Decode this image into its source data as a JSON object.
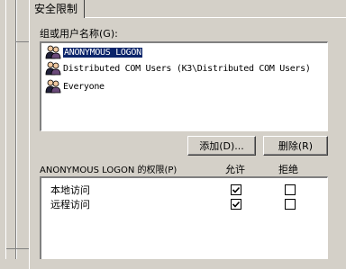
{
  "tab": {
    "label": "安全限制"
  },
  "group": {
    "label": "组或用户名称(G):"
  },
  "users": [
    {
      "name": "ANONYMOUS LOGON",
      "selected": true,
      "icon": "users-icon"
    },
    {
      "name": "Distributed COM Users (K3\\Distributed COM Users)",
      "selected": false,
      "icon": "users-icon"
    },
    {
      "name": "Everyone",
      "selected": false,
      "icon": "users-icon"
    }
  ],
  "buttons": {
    "add": "添加(D)...",
    "remove": "删除(R)"
  },
  "permissions": {
    "title": "ANONYMOUS LOGON 的权限(P)",
    "allow_header": "允许",
    "deny_header": "拒绝",
    "rows": [
      {
        "name": "本地访问",
        "allow": true,
        "deny": false
      },
      {
        "name": "远程访问",
        "allow": true,
        "deny": false
      }
    ]
  },
  "colors": {
    "face": "#d4d0c8",
    "selection": "#0a246a"
  }
}
